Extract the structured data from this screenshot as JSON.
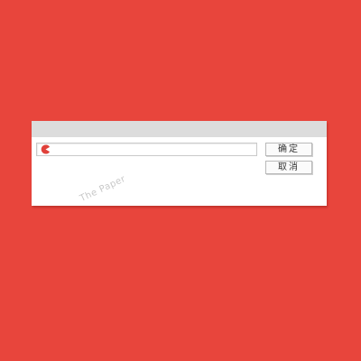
{
  "dialog": {
    "input": {
      "value": "",
      "icon": "pacman-icon"
    },
    "buttons": {
      "ok_label": "确定",
      "cancel_label": "取消"
    },
    "watermark": "The Paper"
  },
  "colors": {
    "background": "#e8453c",
    "titlebar": "#dcdcdc",
    "icon": "#e0413a"
  }
}
